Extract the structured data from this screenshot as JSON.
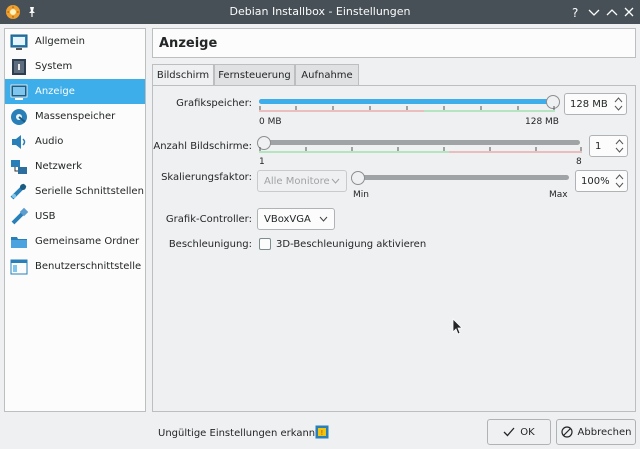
{
  "window": {
    "title": "Debian Installbox - Einstellungen"
  },
  "sidebar": {
    "items": [
      {
        "label": "Allgemein",
        "icon": "general-icon"
      },
      {
        "label": "System",
        "icon": "system-icon"
      },
      {
        "label": "Anzeige",
        "icon": "display-icon",
        "selected": true
      },
      {
        "label": "Massenspeicher",
        "icon": "storage-icon"
      },
      {
        "label": "Audio",
        "icon": "audio-icon"
      },
      {
        "label": "Netzwerk",
        "icon": "network-icon"
      },
      {
        "label": "Serielle Schnittstellen",
        "icon": "serial-port-icon"
      },
      {
        "label": "USB",
        "icon": "usb-icon"
      },
      {
        "label": "Gemeinsame Ordner",
        "icon": "shared-folder-icon"
      },
      {
        "label": "Benutzerschnittstelle",
        "icon": "user-interface-icon"
      }
    ]
  },
  "page": {
    "title": "Anzeige",
    "tabs": [
      "Bildschirm",
      "Fernsteuerung",
      "Aufnahme"
    ],
    "active_tab": "Bildschirm"
  },
  "settings": {
    "video_memory": {
      "label": "Grafikspeicher:",
      "value": "128 MB",
      "min_label": "0 MB",
      "max_label": "128 MB",
      "fraction": 1.0
    },
    "monitor_count": {
      "label": "Anzahl Bildschirme:",
      "value": "1",
      "min_label": "1",
      "max_label": "8",
      "fraction": 0.0
    },
    "scale_factor": {
      "label": "Skalierungsfaktor:",
      "combo_value": "Alle Monitore",
      "value": "100%",
      "min_label": "Min",
      "max_label": "Max",
      "fraction": 0.0
    },
    "graphics_controller": {
      "label": "Grafik-Controller:",
      "value": "VBoxVGA"
    },
    "acceleration": {
      "label": "Beschleunigung:",
      "checkbox_label": "3D-Beschleunigung aktivieren",
      "checked": false
    }
  },
  "footer": {
    "status": "Ungültige Einstellungen erkannt",
    "ok_label": "OK",
    "cancel_label": "Abbrechen"
  },
  "colors": {
    "accent": "#3daee9",
    "titlebar": "#475057",
    "green_range": "#7bd88f",
    "red_range": "#e58b8b"
  }
}
